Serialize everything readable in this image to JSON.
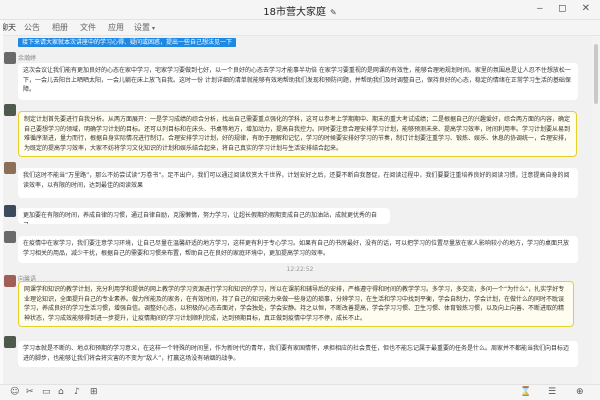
{
  "window": {
    "title": "18市营大家庭",
    "edit_icon": "✎",
    "controls": "‒ ◻ ✕"
  },
  "tabs": [
    "聊天",
    "公告",
    "相册",
    "文件",
    "应用",
    "设置"
  ],
  "notice": "接下来请大家就本次讲座中的学习心得、疑问或困惑，提出一些自己想法见一下",
  "messages": [
    {
      "sender": "余瀚婷",
      "text": "这次会议让我们能有更加良好的心态在家中学习，宅家学习要做到七好，以一个良好的心态去学习才能事半功倍 在家学习要重视的是网课的有效性，能够合理地规划时间。家里的氛围总是让人忍不住想放松一下，一会儿去阳台上晒晒太阳，一会儿躺在床上放飞自我。这时一份 计划详细的清单就能够有效地帮助我们发现和预防问题，并帮助我们及时调整自己，保持良好的心态，稳定的情绪在正常学习生活的基础保障。"
    },
    {
      "sender": "",
      "text": "制定计划首先要进行自我分析。从两方面展开：一是学习成绩的综合分析，找出自己需要重点强化的学科，这可以参考上学期期中、期末的重大考试成绩；二是根据自己的兴趣爱好，综合两方面的内容，确定自己要想学习的领域，明确学习计划的目标。还可以列目标和在床头、书桌等地方，增加动力，提高自我控力。同时要注意合理安排学习计划，能够预测未来、提高学习效率，时间利用率。学习计划要从易到难循序渐进，量力而行，根据自身实际情况进行制订。合理安排学习计划，好的规律，有助于理解和记忆，学习的时候要安排好学习的节奏，制订计划要注重学习、锻炼、娱乐、休息的协调统一，合理安排，为既定的提高学习效率，大家不妨将学习文化知识的计划和娱乐结合起来，将自己真实的学习计划与生活安排结合起来。"
    },
    {
      "sender": "",
      "text": "我们这时不能当“万里路”，那么不妨尝试读“万卷书”。足不出户，我们可以通过阅读欣赏大千世界，计划安好之后，还要不断自我督促，在阅读过程中，我们要要注重培养良好的阅读习惯，注意提高自身的阅读效率，以有限的时间，达到最佳的阅读效果"
    },
    {
      "sender": "",
      "text": "更加要在有限的时间，养成自律的习惯，通过自律自励，克服懒惰，努力学习，让超长假期的假期变成自己的加油站，成就更优秀的自己。"
    },
    {
      "sender": "",
      "text": "在疫情中在家学习，我们要注意学习环境，让自己尽量在温馨舒适的地方学习，这样更有利于专心学习。如果有自己的书房最好，没有的话，可以把学习的位置尽量放在家人影响较小的地方，学习的桌面只放学习相关的用品，减少干扰，根据自己的需要和习惯来布置，帮助自己在良好的家庭环境中，更加提高学习的效率。"
    },
    {
      "sender": "向馨语",
      "text": "网课学和知识的教学计划，充分利用学和提供的网上教学的学习资源进行学习和知识的学习，所以在课前和辅导后的安排，严格遵守得和时间的教学学习。多学习，多交流，多问一个“为什么”，扎实学好专业理论知识，全面提升自己的专业素养。做力所能及的家务，在有效时间，持了自己的知识能力来做一些身边的琐事，分辨学习，在生活和学习中找到平衡，学会自制力，学会计划，在做什么的同时不耽误学习，养成良好的学习生活习惯，增强自信。调整好心态，以积极的心态去面对，学会独处，学会安静。持之以恒，不断改善提高，学会学习习惯、卫生习惯、体育锻炼习惯，以及向上向善、不断进取的精神状态，学习成效能够得到进一步提升，让疫情期间的学习计划顺利完成，达到预期目标，真正做到疫情中学习不停，成长不止。"
    },
    {
      "sender": "",
      "text": "学习本就是不断的、地点和预期的学习意义，在这样一个特殊的时间里，作为新时代的青年，我们要有家国情怀，承担相应的社会责任，但也不能忘记属于最重要的任务是什么。周家并不都能当我们向目标迈进的脚步，也能够让我们将会将灾害的不变为“敌人”，打赢这场没有硝烟的战争。"
    }
  ],
  "timestamp": "12:22:52",
  "bottom_icons": [
    "☺",
    "✂",
    "▭",
    "⌂",
    "♪",
    "⊞",
    "⌛",
    "☰",
    "⊕"
  ]
}
